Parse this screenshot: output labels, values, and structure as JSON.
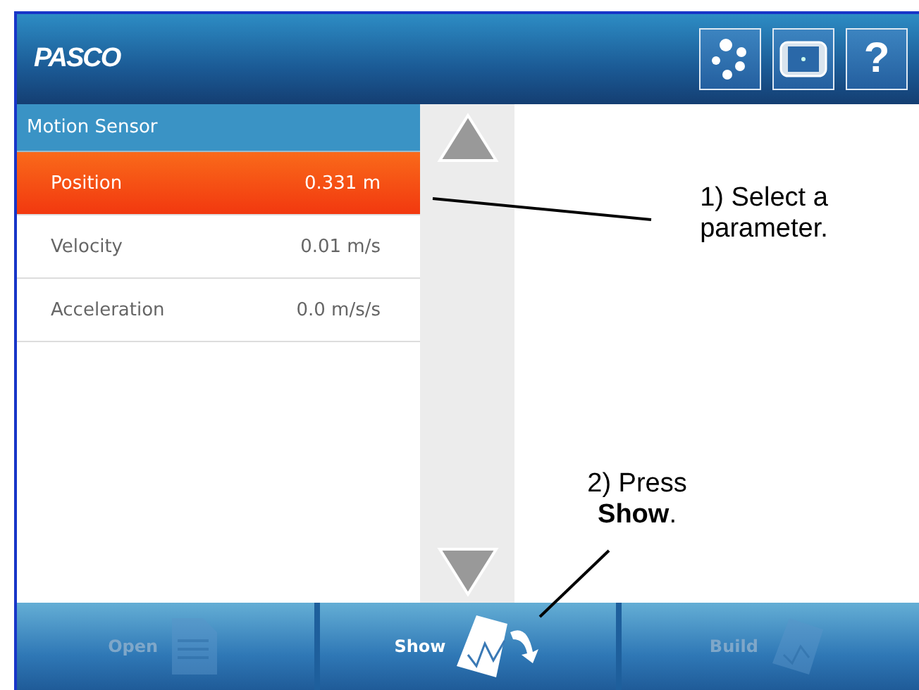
{
  "header": {
    "logo": "PASCO",
    "buttons": [
      {
        "kind": "sensors"
      },
      {
        "kind": "device"
      },
      {
        "kind": "help",
        "label": "?"
      }
    ]
  },
  "sensor_list": {
    "title": "Motion Sensor",
    "items": [
      {
        "name": "Position",
        "value": "0.331 m",
        "selected": true
      },
      {
        "name": "Velocity",
        "value": "0.01 m/s",
        "selected": false
      },
      {
        "name": "Acceleration",
        "value": "0.0 m/s/s",
        "selected": false
      }
    ]
  },
  "bottom_bar": {
    "buttons": [
      {
        "kind": "open",
        "label": "Open",
        "disabled": true
      },
      {
        "kind": "show",
        "label": "Show",
        "disabled": false
      },
      {
        "kind": "build",
        "label": "Build",
        "disabled": true
      }
    ]
  },
  "annotations": [
    {
      "kind": "select",
      "text": "1) Select a parameter."
    },
    {
      "kind": "press",
      "text": "2) Press **Show**."
    }
  ]
}
